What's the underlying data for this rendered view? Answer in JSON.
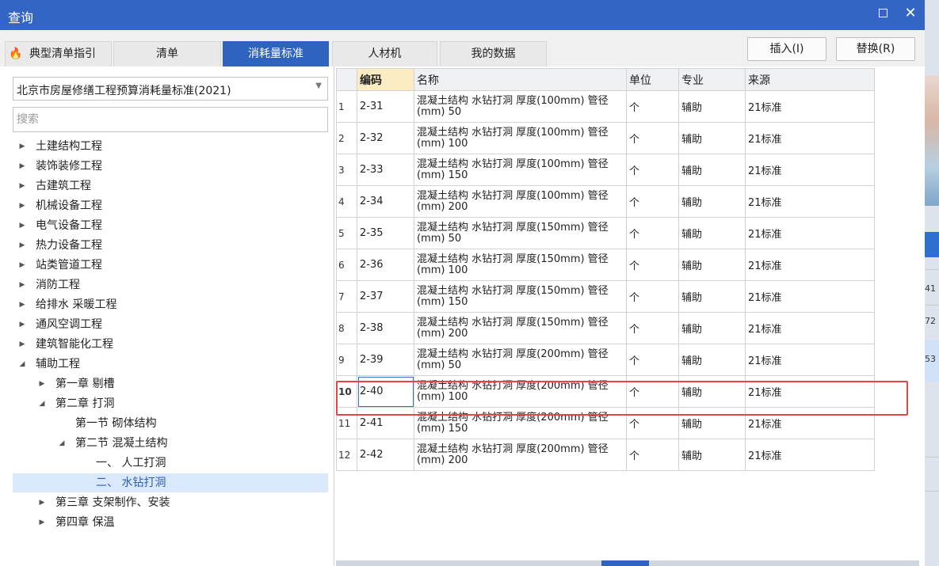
{
  "window": {
    "title": "查询"
  },
  "tabs": [
    {
      "label": "典型清单指引"
    },
    {
      "label": "清单"
    },
    {
      "label": "消耗量标准"
    },
    {
      "label": "人材机"
    },
    {
      "label": "我的数据"
    }
  ],
  "actions": {
    "insert": "插入(I)",
    "replace": "替换(R)"
  },
  "left": {
    "standard": "北京市房屋修缮工程预算消耗量标准(2021)",
    "search_placeholder": "搜索",
    "tree": [
      {
        "label": "土建结构工程",
        "level": 0,
        "state": "collapsed"
      },
      {
        "label": "装饰装修工程",
        "level": 0,
        "state": "collapsed"
      },
      {
        "label": "古建筑工程",
        "level": 0,
        "state": "collapsed"
      },
      {
        "label": "机械设备工程",
        "level": 0,
        "state": "collapsed"
      },
      {
        "label": "电气设备工程",
        "level": 0,
        "state": "collapsed"
      },
      {
        "label": "热力设备工程",
        "level": 0,
        "state": "collapsed"
      },
      {
        "label": "站类管道工程",
        "level": 0,
        "state": "collapsed"
      },
      {
        "label": "消防工程",
        "level": 0,
        "state": "collapsed"
      },
      {
        "label": "给排水 采暖工程",
        "level": 0,
        "state": "collapsed"
      },
      {
        "label": "通风空调工程",
        "level": 0,
        "state": "collapsed"
      },
      {
        "label": "建筑智能化工程",
        "level": 0,
        "state": "collapsed"
      },
      {
        "label": "辅助工程",
        "level": 0,
        "state": "expanded"
      },
      {
        "label": "第一章 剔槽",
        "level": 1,
        "state": "collapsed"
      },
      {
        "label": "第二章 打洞",
        "level": 1,
        "state": "expanded"
      },
      {
        "label": "第一节 砌体结构",
        "level": 2,
        "state": "leaf"
      },
      {
        "label": "第二节 混凝土结构",
        "level": 2,
        "state": "expanded"
      },
      {
        "label": "一、 人工打洞",
        "level": 3,
        "state": "leaf"
      },
      {
        "label": "二、 水钻打洞",
        "level": 3,
        "state": "leaf",
        "selected": true
      },
      {
        "label": "第三章 支架制作、安装",
        "level": 1,
        "state": "collapsed"
      },
      {
        "label": "第四章 保温",
        "level": 1,
        "state": "collapsed"
      }
    ]
  },
  "grid": {
    "columns": [
      "编码",
      "名称",
      "单位",
      "专业",
      "来源"
    ],
    "rows": [
      {
        "no": "1",
        "code": "2-31",
        "name": "混凝土结构 水钻打洞 厚度(100mm) 管径(mm) 50",
        "unit": "个",
        "major": "辅助",
        "source": "21标准"
      },
      {
        "no": "2",
        "code": "2-32",
        "name": "混凝土结构 水钻打洞 厚度(100mm) 管径(mm) 100",
        "unit": "个",
        "major": "辅助",
        "source": "21标准"
      },
      {
        "no": "3",
        "code": "2-33",
        "name": "混凝土结构 水钻打洞 厚度(100mm) 管径(mm) 150",
        "unit": "个",
        "major": "辅助",
        "source": "21标准"
      },
      {
        "no": "4",
        "code": "2-34",
        "name": "混凝土结构 水钻打洞 厚度(100mm) 管径(mm) 200",
        "unit": "个",
        "major": "辅助",
        "source": "21标准"
      },
      {
        "no": "5",
        "code": "2-35",
        "name": "混凝土结构 水钻打洞 厚度(150mm) 管径(mm) 50",
        "unit": "个",
        "major": "辅助",
        "source": "21标准"
      },
      {
        "no": "6",
        "code": "2-36",
        "name": "混凝土结构 水钻打洞 厚度(150mm) 管径(mm) 100",
        "unit": "个",
        "major": "辅助",
        "source": "21标准"
      },
      {
        "no": "7",
        "code": "2-37",
        "name": "混凝土结构 水钻打洞 厚度(150mm) 管径(mm) 150",
        "unit": "个",
        "major": "辅助",
        "source": "21标准"
      },
      {
        "no": "8",
        "code": "2-38",
        "name": "混凝土结构 水钻打洞 厚度(150mm) 管径(mm) 200",
        "unit": "个",
        "major": "辅助",
        "source": "21标准"
      },
      {
        "no": "9",
        "code": "2-39",
        "name": "混凝土结构 水钻打洞 厚度(200mm) 管径(mm) 50",
        "unit": "个",
        "major": "辅助",
        "source": "21标准"
      },
      {
        "no": "10",
        "code": "2-40",
        "name": "混凝土结构 水钻打洞 厚度(200mm) 管径(mm) 100",
        "unit": "个",
        "major": "辅助",
        "source": "21标准",
        "current": true
      },
      {
        "no": "11",
        "code": "2-41",
        "name": "混凝土结构 水钻打洞 厚度(200mm) 管径(mm) 150",
        "unit": "个",
        "major": "辅助",
        "source": "21标准"
      },
      {
        "no": "12",
        "code": "2-42",
        "name": "混凝土结构 水钻打洞 厚度(200mm) 管径(mm) 200",
        "unit": "个",
        "major": "辅助",
        "source": "21标准"
      }
    ]
  },
  "background_window": {
    "cells": [
      "41",
      "72",
      "53"
    ]
  },
  "colors": {
    "accent": "#2e63c0",
    "titlebar": "#3366c4",
    "highlight": "#e64545",
    "code_header": "#fbecc4"
  }
}
